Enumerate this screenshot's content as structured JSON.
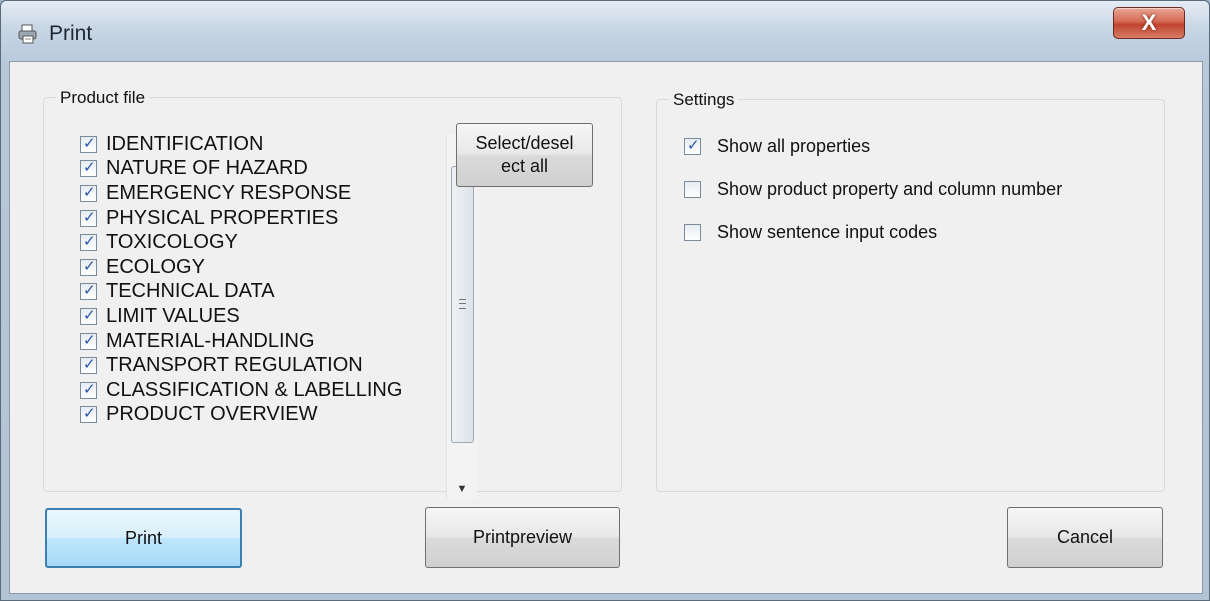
{
  "window": {
    "title": "Print",
    "close_symbol": "X"
  },
  "product_file": {
    "group_title": "Product file",
    "items": [
      {
        "label": "IDENTIFICATION",
        "checked": true
      },
      {
        "label": "NATURE OF HAZARD",
        "checked": true
      },
      {
        "label": "EMERGENCY RESPONSE",
        "checked": true
      },
      {
        "label": "PHYSICAL PROPERTIES",
        "checked": true
      },
      {
        "label": "TOXICOLOGY",
        "checked": true
      },
      {
        "label": "ECOLOGY",
        "checked": true
      },
      {
        "label": "TECHNICAL DATA",
        "checked": true
      },
      {
        "label": "LIMIT VALUES",
        "checked": true
      },
      {
        "label": "MATERIAL-HANDLING",
        "checked": true
      },
      {
        "label": "TRANSPORT REGULATION",
        "checked": true
      },
      {
        "label": "CLASSIFICATION & LABELLING",
        "checked": true
      },
      {
        "label": "PRODUCT OVERVIEW",
        "checked": true
      }
    ],
    "select_all_line1": "Select/desel",
    "select_all_line2": "ect all"
  },
  "settings": {
    "group_title": "Settings",
    "options": [
      {
        "label": "Show all properties",
        "checked": true
      },
      {
        "label": "Show product property and column number",
        "checked": false
      },
      {
        "label": "Show sentence input codes",
        "checked": false
      }
    ]
  },
  "buttons": {
    "print": "Print",
    "printpreview": "Printpreview",
    "cancel": "Cancel"
  },
  "icons": {
    "app": "printer-icon",
    "close": "close-icon",
    "scroll_up": "scroll-up-arrow-icon",
    "scroll_down": "scroll-down-arrow-icon"
  },
  "colors": {
    "close_button": "#c0432e",
    "default_button_border": "#3c7fb1",
    "check_mark": "#2a56a8"
  }
}
